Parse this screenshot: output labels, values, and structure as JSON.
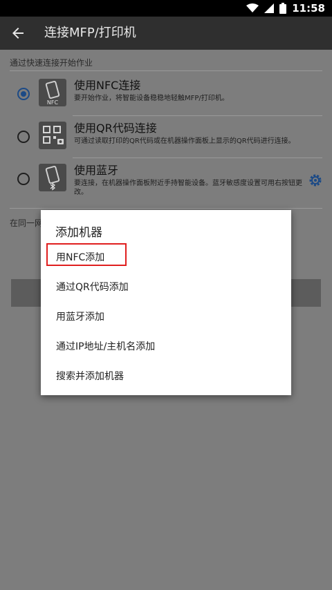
{
  "status_bar": {
    "time": "11:58"
  },
  "app_bar": {
    "title": "连接MFP/打印机"
  },
  "sections": {
    "quick_connect_label": "通过快速连接开始作业",
    "same_network_label": "在同一网"
  },
  "options": [
    {
      "title": "使用NFC连接",
      "desc": "要开始作业，将智能设备稳稳地轻触MFP/打印机。",
      "selected": true,
      "icon": "nfc-phone-icon",
      "icon_text": "NFC"
    },
    {
      "title": "使用QR代码连接",
      "desc": "可通过读取打印的QR代码或在机器操作面板上显示的QR代码进行连接。",
      "selected": false,
      "icon": "qr-code-icon"
    },
    {
      "title": "使用蓝牙",
      "desc": "要连接，在机器操作面板附近手持智能设备。蓝牙敏感度设置可用右按钮更改。",
      "selected": false,
      "icon": "bluetooth-phone-icon"
    }
  ],
  "dialog": {
    "title": "添加机器",
    "items": [
      {
        "label": "用NFC添加"
      },
      {
        "label": "通过QR代码添加"
      },
      {
        "label": "用蓝牙添加"
      },
      {
        "label": "通过IP地址/主机名添加"
      },
      {
        "label": "搜索并添加机器"
      }
    ]
  },
  "colors": {
    "accent": "#1c4a86",
    "highlight": "#e01e1e"
  }
}
